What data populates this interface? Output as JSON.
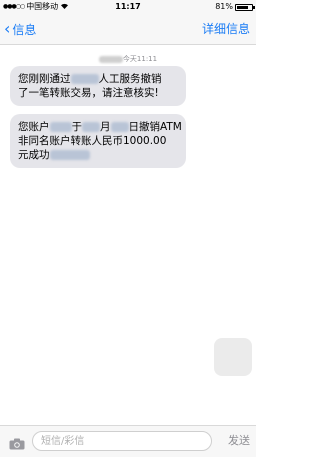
{
  "status_bar": {
    "signal": "●●●○○",
    "carrier": "中国移动",
    "time": "11:17",
    "battery": "81%",
    "battery_level": 0.81
  },
  "nav": {
    "back_label": "信息",
    "details_label": "详细信息"
  },
  "conversation": {
    "timestamp": "今天11:11",
    "messages": [
      {
        "part1": "您刚刚通过",
        "part2": "人工服务撤销",
        "line2": "了一笔转账交易，请注意核实!"
      },
      {
        "part1": "您账户",
        "part2": "于",
        "part3": "月",
        "part4": "日撤销ATM",
        "line2": "非同名账户转账人民币1000.00",
        "line3": "元成功"
      }
    ]
  },
  "input_bar": {
    "placeholder": "短信/彩信",
    "send_label": "发送"
  }
}
